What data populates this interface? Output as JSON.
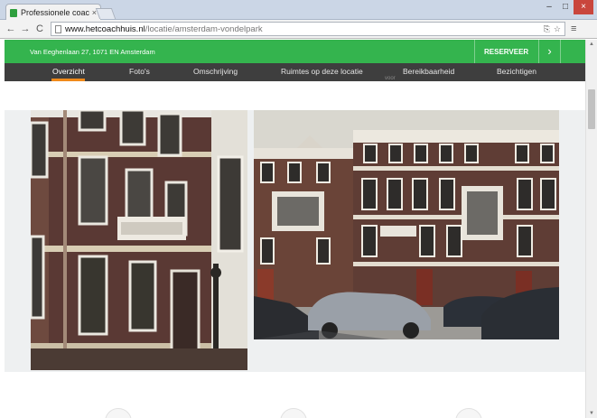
{
  "browser": {
    "tab_title": "Professionele coach",
    "tab_close": "×",
    "url_host": "www.hetcoachhuis.nl",
    "url_path": "/locatie/amsterdam-vondelpark",
    "back": "←",
    "forward": "→",
    "reload": "C",
    "menu": "≡",
    "minimize": "–",
    "maximize": "□",
    "close": "×"
  },
  "header": {
    "address": "Van Eeghenlaan 27, 1071 EN Amsterdam",
    "reserve_label": "RESERVEER",
    "reserve_arrow": "›",
    "brand_color": "#34b44e"
  },
  "subnav": {
    "items": [
      {
        "label": "Overzicht",
        "active": true
      },
      {
        "label": "Foto's"
      },
      {
        "label": "Omschrijving"
      },
      {
        "label": "Ruimtes op deze locatie"
      },
      {
        "label": "Bereikbaarheid"
      },
      {
        "label": "Bezichtigen"
      }
    ],
    "overflow_text": "voor",
    "active_color": "#f08a1a"
  },
  "icons": {
    "favicon": "coachhuis-favicon",
    "page": "page-icon",
    "translate": "translate-icon",
    "star": "star-icon"
  }
}
